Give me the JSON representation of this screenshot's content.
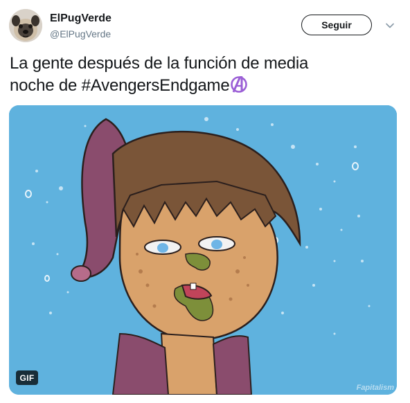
{
  "author": {
    "display_name": "ElPugVerde",
    "handle": "@ElPugVerde",
    "avatar_icon": "pug-avatar"
  },
  "actions": {
    "follow_label": "Seguir",
    "menu_icon": "chevron-down-icon"
  },
  "tweet": {
    "text_line1": "La gente después de la función de media",
    "text_line2_prefix": "noche de ",
    "hashtag": "#AvengersEndgame",
    "emoji": "avengers-logo-emoji"
  },
  "media": {
    "type_badge": "GIF",
    "watermark": "Fapitalism",
    "background_color": "#5fb2de"
  },
  "colors": {
    "text": "#14171a",
    "secondary_text": "#657786",
    "emoji_purple": "#9b5fd6"
  }
}
